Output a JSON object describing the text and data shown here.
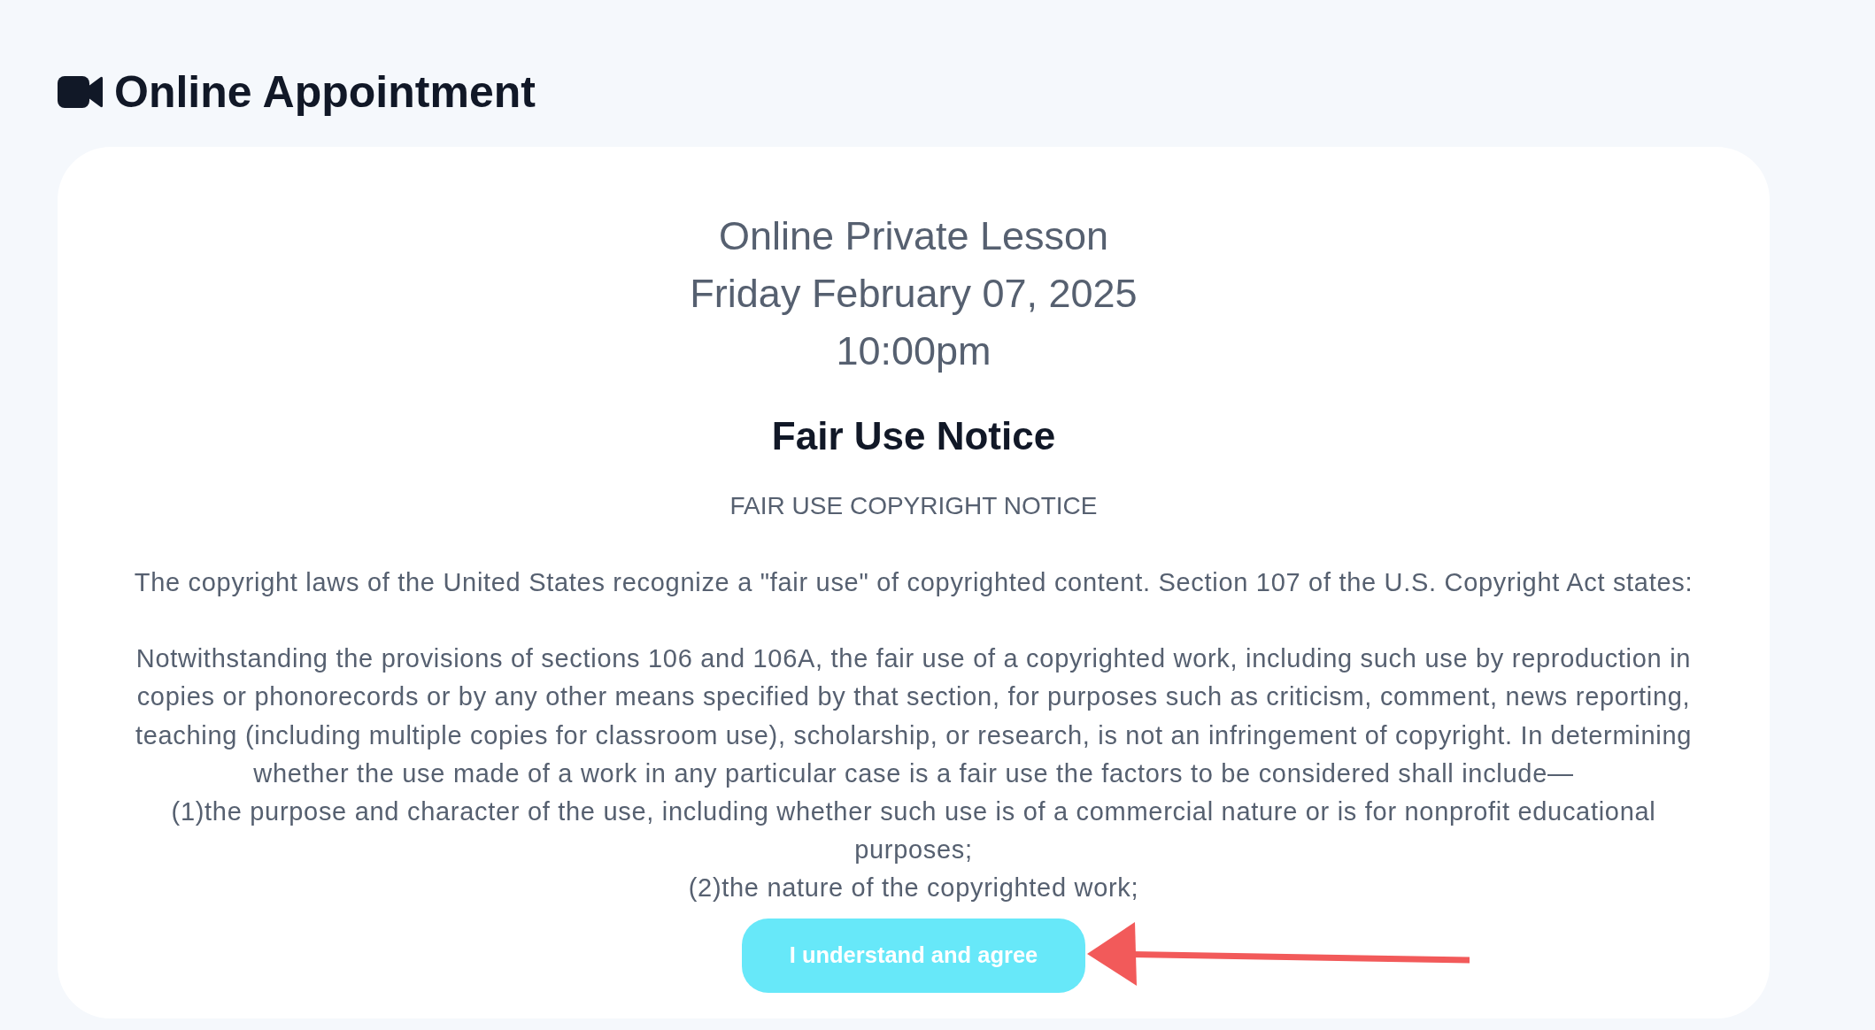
{
  "page": {
    "title": "Online Appointment"
  },
  "appointment": {
    "lesson": "Online Private Lesson",
    "date": "Friday February 07, 2025",
    "time": "10:00pm"
  },
  "notice": {
    "heading": "Fair Use Notice",
    "subheading": "FAIR USE COPYRIGHT NOTICE",
    "intro": "The copyright laws of the United States recognize a \"fair use\" of copyrighted content. Section 107 of the U.S. Copyright Act states:",
    "statute": [
      "Notwithstanding the provisions of sections 106 and 106A, the fair use of a copyrighted work, including such use by reproduction in copies or phonorecords or by any other means specified by that section, for purposes such as criticism, comment, news reporting, teaching (including multiple copies for classroom use), scholarship, or research, is not an infringement of copyright. In determining whether the use made of a work in any particular case is a fair use the factors to be considered shall include—",
      "(1)the purpose and character of the use, including whether such use is of a commercial nature or is for nonprofit educational purposes;",
      "(2)the nature of the copyrighted work;"
    ]
  },
  "agree_button": {
    "label": "I understand and agree"
  }
}
